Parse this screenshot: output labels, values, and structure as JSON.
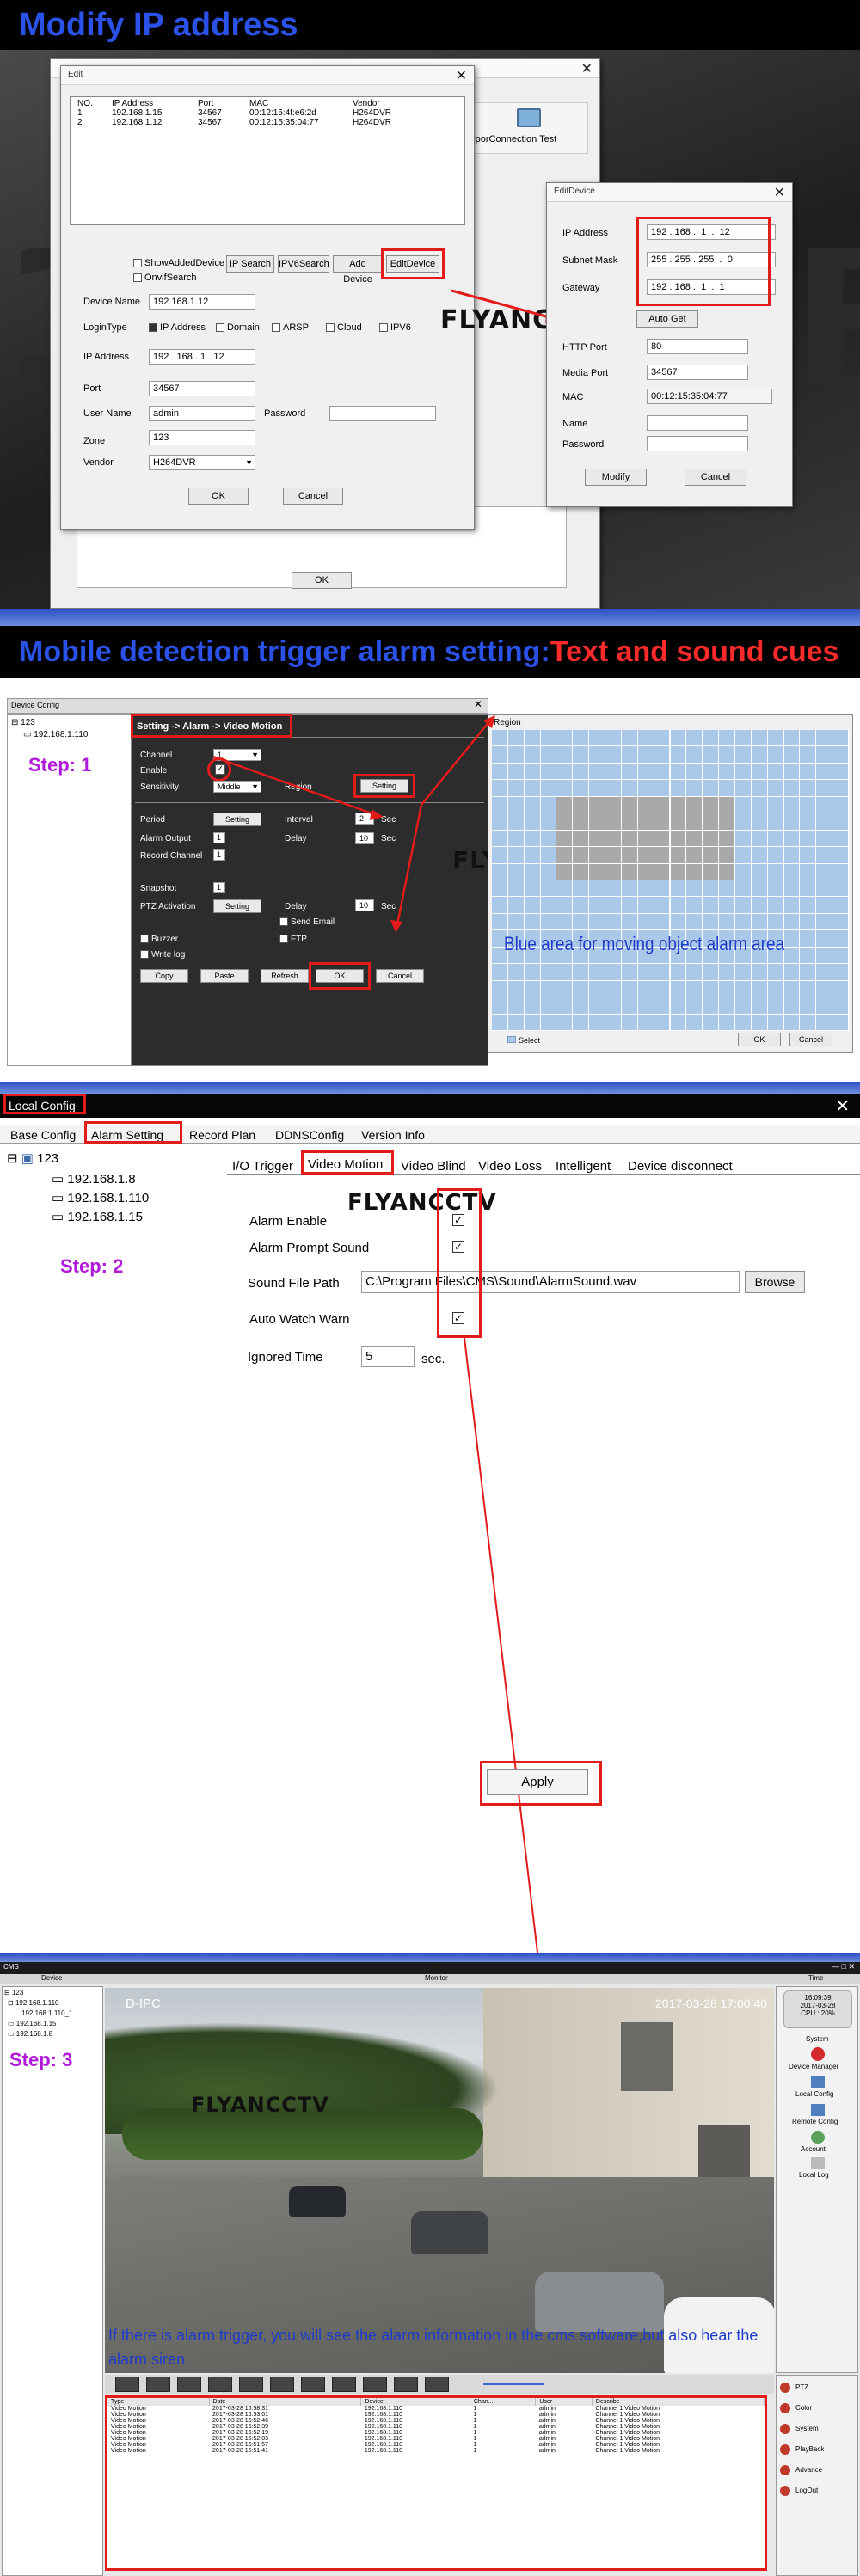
{
  "sec1": {
    "banner": "Modify IP address",
    "edit": {
      "title": "Edit",
      "columns": [
        "NO.",
        "IP Address",
        "Port",
        "MAC",
        "Vendor"
      ],
      "rows": [
        [
          "1",
          "192.168.1.15",
          "34567",
          "00:12:15:4f:e6:2d",
          "H264DVR"
        ],
        [
          "2",
          "192.168.1.12",
          "34567",
          "00:12:15:35:04:77",
          "H264DVR"
        ]
      ],
      "show_added": "ShowAddedDevice",
      "onvif_search": "OnvifSearch",
      "ip_search": "IP Search",
      "ipv6_search": "IPV6Search",
      "add_device": "Add Device",
      "edit_device": "EditDevice",
      "device_name_label": "Device Name",
      "device_name": "192.168.1.12",
      "login_type_label": "LoginType",
      "opt_ip": "IP Address",
      "opt_domain": "Domain",
      "opt_arsp": "ARSP",
      "opt_cloud": "Cloud",
      "opt_ipv6": "IPV6",
      "ip_label": "IP Address",
      "ip_value": "192 . 168 . 1 . 12",
      "port_label": "Port",
      "port_value": "34567",
      "user_label": "User Name",
      "user_value": "admin",
      "password_label": "Password",
      "zone_label": "Zone",
      "zone_value": "123",
      "vendor_label": "Vendor",
      "vendor_value": "H264DVR",
      "ok": "OK",
      "cancel": "Cancel"
    },
    "back_ok": "OK",
    "back_text": "rporConnection Test",
    "watermark": "FLYANCCTV",
    "editdevice": {
      "title": "EditDevice",
      "ip_label": "IP Address",
      "ip": [
        "192",
        "168",
        "1",
        "12"
      ],
      "mask_label": "Subnet Mask",
      "mask": [
        "255",
        "255",
        "255",
        "0"
      ],
      "gw_label": "Gateway",
      "gw": [
        "192",
        "168",
        "1",
        "1"
      ],
      "auto_get": "Auto Get",
      "http_label": "HTTP Port",
      "http": "80",
      "media_label": "Media Port",
      "media": "34567",
      "mac_label": "MAC",
      "mac": "00:12:15:35:04:77",
      "name_label": "Name",
      "pwd_label": "Password",
      "modify": "Modify",
      "cancel": "Cancel"
    }
  },
  "sec2": {
    "banner_a": "Mobile detection trigger alarm setting:",
    "banner_b": "Text and sound cues",
    "tree_root": "123",
    "tree_child": "192.168.1.110",
    "step": "Step: 1",
    "dialog_title": "Device Config",
    "breadcrumb": "Setting -> Alarm -> Video Motion",
    "channel_label": "Channel",
    "channel": "1",
    "enable_label": "Enable",
    "sens_label": "Sensitivity",
    "sens": "Middle",
    "region_label": "Region",
    "setting": "Setting",
    "period_label": "Period",
    "interval_label": "Interval",
    "interval": "2",
    "sec": "Sec",
    "alarm_out_label": "Alarm Output",
    "alarm_out": "1",
    "delay_label": "Delay",
    "delay": "10",
    "record_label": "Record Channel",
    "record": "1",
    "snapshot_label": "Snapshot",
    "snapshot": "1",
    "ptz_label": "PTZ Activation",
    "ptz_delay": "10",
    "send_email": "Send Email",
    "ftp": "FTP",
    "buzzer": "Buzzer",
    "write_log": "Write log",
    "copy": "Copy",
    "paste": "Paste",
    "refresh": "Refresh",
    "ok": "OK",
    "cancel": "Cancel",
    "watermark": "FLYANCCTV",
    "region_title": "Region",
    "region_caption": "Blue area for moving object alarm area",
    "select": "Select",
    "region_ok": "OK",
    "region_cancel": "Cancel"
  },
  "sec3": {
    "title": "Local Config",
    "tabs": [
      "Base Config",
      "Alarm Setting",
      "Record Plan",
      "DDNSConfig",
      "Version Info"
    ],
    "tree_root": "123",
    "tree": [
      "192.168.1.8",
      "192.168.1.110",
      "192.168.1.15"
    ],
    "step": "Step: 2",
    "subtabs": [
      "I/O Trigger",
      "Video Motion",
      "Video Blind",
      "Video Loss",
      "Intelligent",
      "Device disconnect"
    ],
    "watermark": "FLYANCCTV",
    "alarm_enable": "Alarm Enable",
    "prompt_sound": "Alarm Prompt Sound",
    "sound_path_label": "Sound File Path",
    "sound_path": "C:\\Program Files\\CMS\\Sound\\AlarmSound.wav",
    "browse": "Browse",
    "auto_watch": "Auto Watch Warn",
    "ignored_label": "Ignored Time",
    "ignored": "5",
    "sec": "sec.",
    "apply": "Apply"
  },
  "sec4": {
    "app": "CMS",
    "col_device": "Device",
    "col_monitor": "Monitor",
    "col_time": "Time",
    "tree": [
      "192.168.1.110",
      "192.168.1.110_1",
      "192.168.1.15",
      "192.168.1.8"
    ],
    "tree_root": "123",
    "step": "Step: 3",
    "cam_label": "D-IPC",
    "cam_time": "2017-03-28  17:00:40",
    "clock": "16:09:39",
    "date": "2017-03-28",
    "cpu": "CPU : 20%",
    "menu": [
      "System",
      "Device Manager",
      "Local Config",
      "Remote Config",
      "Account",
      "Local Log"
    ],
    "watermark": "FLYANCCTV",
    "note": "If there is alarm trigger, you will see the alarm information in the cms software,but also hear the alarm siren.",
    "bottom_menu": [
      "PTZ",
      "Color",
      "System",
      "PlayBack",
      "Advance",
      "LogOut"
    ],
    "log_headers": [
      "Type",
      "Date",
      "Device",
      "Chan...",
      "User",
      "Describe"
    ],
    "log_rows": [
      [
        "Video Motion",
        "2017-03-28 16:58:31",
        "192.168.1.110",
        "1",
        "admin",
        "Channel 1 Video Motion"
      ],
      [
        "Video Motion",
        "2017-03-28 16:53:01",
        "192.168.1.110",
        "1",
        "admin",
        "Channel 1 Video Motion"
      ],
      [
        "Video Motion",
        "2017-03-28 16:52:46",
        "192.168.1.110",
        "1",
        "admin",
        "Channel 1 Video Motion"
      ],
      [
        "Video Motion",
        "2017-03-28 16:52:39",
        "192.168.1.110",
        "1",
        "admin",
        "Channel 1 Video Motion"
      ],
      [
        "Video Motion",
        "2017-03-28 16:52:19",
        "192.168.1.110",
        "1",
        "admin",
        "Channel 1 Video Motion"
      ],
      [
        "Video Motion",
        "2017-03-28 16:52:03",
        "192.168.1.110",
        "1",
        "admin",
        "Channel 1 Video Motion"
      ],
      [
        "Video Motion",
        "2017-03-28 16:51:57",
        "192.168.1.110",
        "1",
        "admin",
        "Channel 1 Video Motion"
      ],
      [
        "Video Motion",
        "2017-03-28 16:51:41",
        "192.168.1.110",
        "1",
        "admin",
        "Channel 1 Video Motion"
      ]
    ],
    "split_labels": [
      "1",
      "4",
      "6",
      "8",
      "9",
      "10",
      "13",
      "16",
      "25",
      "36",
      "64"
    ]
  },
  "colors": {
    "banner_blue": "#2b52e8",
    "highlight_red": "#e31b1b",
    "step_purple": "#b01ad8",
    "region_blue": "#aac8ea"
  }
}
